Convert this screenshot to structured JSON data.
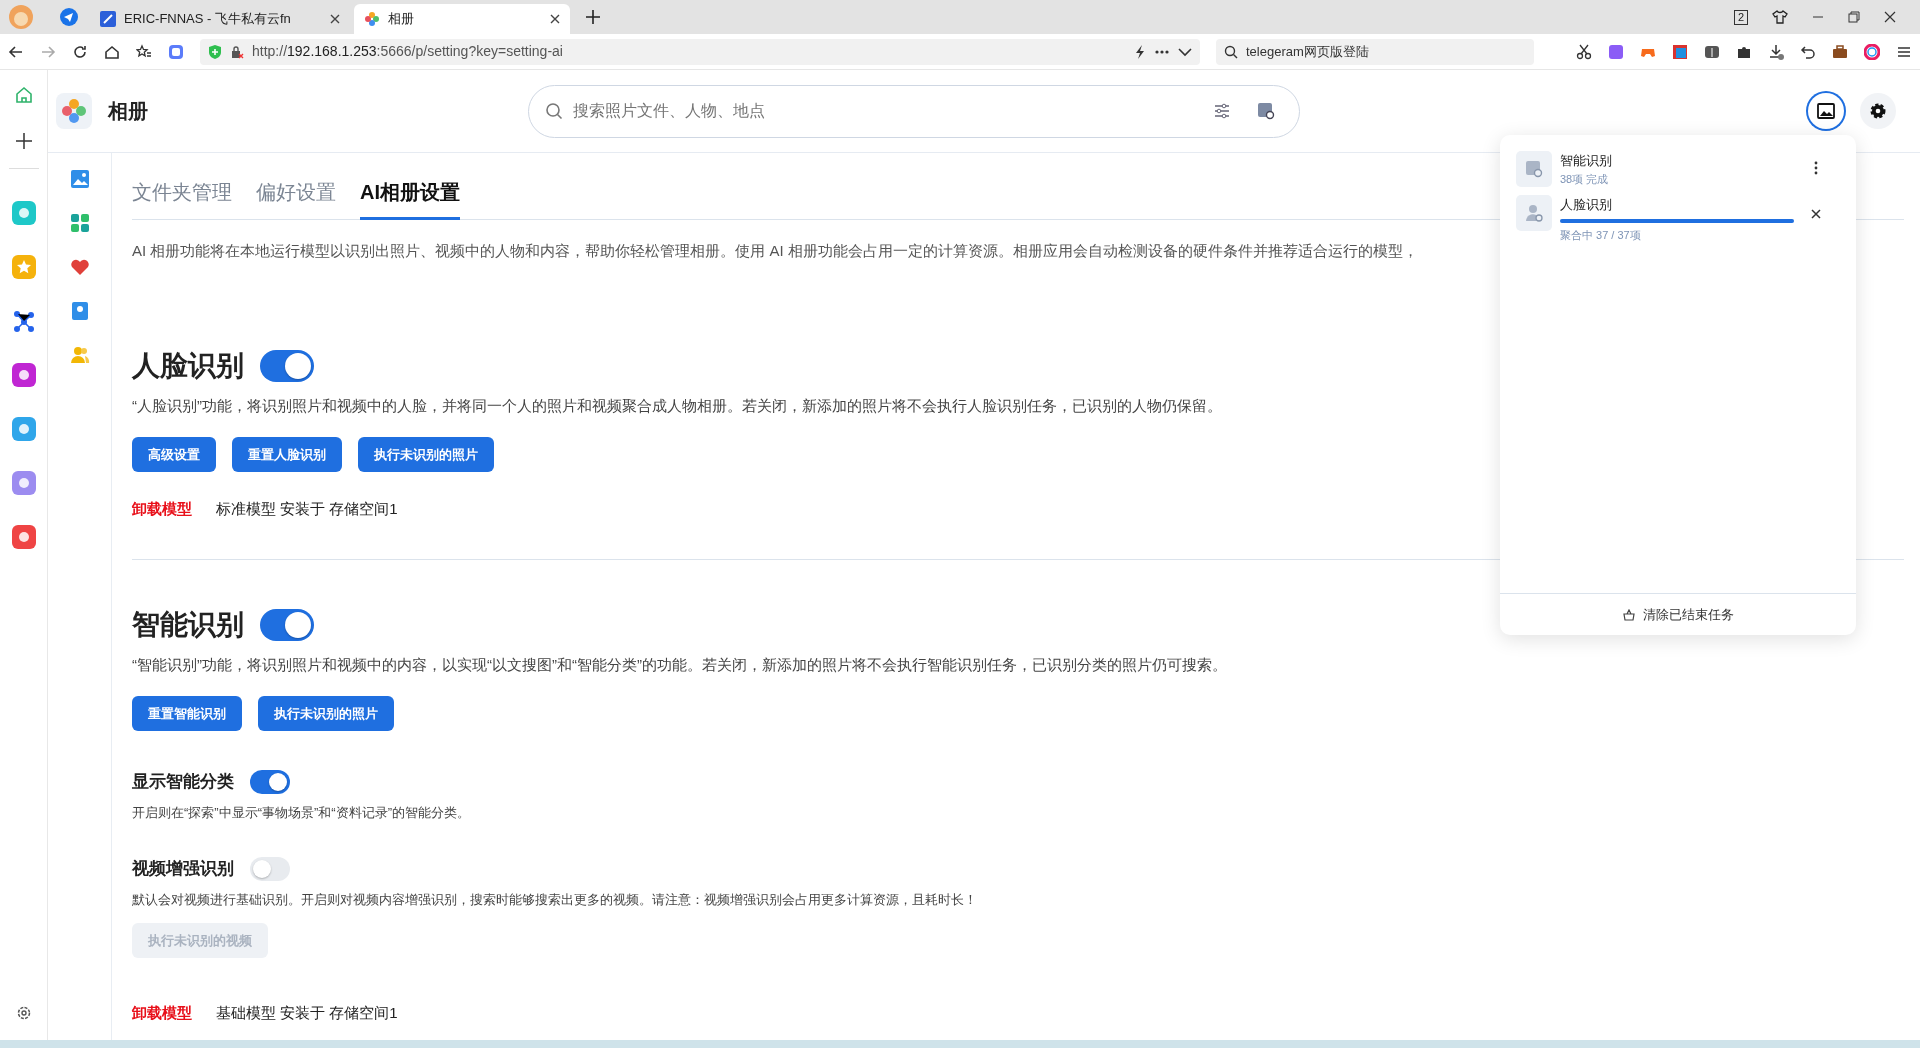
{
  "browser": {
    "tabs": [
      {
        "title": "ERIC-FNNAS - 飞牛私有云fn",
        "selected": false
      },
      {
        "title": "相册",
        "selected": true
      }
    ],
    "tab_count": "2",
    "url": {
      "scheme": "http://",
      "host": "192.168.1.253",
      "path": ":5666/p/setting?key=setting-ai"
    },
    "search": {
      "value": "telegeram网页版登陆"
    }
  },
  "app": {
    "title": "相册",
    "search": {
      "placeholder": "搜索照片文件、人物、地点"
    }
  },
  "tabs": [
    {
      "label": "文件夹管理",
      "selected": false
    },
    {
      "label": "偏好设置",
      "selected": false
    },
    {
      "label": "AI相册设置",
      "selected": true
    }
  ],
  "intro": "AI 相册功能将在本地运行模型以识别出照片、视频中的人物和内容，帮助你轻松管理相册。使用 AI 相册功能会占用一定的计算资源。相册应用会自动检测设备的硬件条件并推荐适合运行的模型，",
  "sections": [
    {
      "title": "人脸识别",
      "on": true,
      "description": "“人脸识别”功能，将识别照片和视频中的人脸，并将同一个人的照片和视频聚合成人物相册。若关闭，新添加的照片将不会执行人脸识别任务，已识别的人物仍保留。",
      "buttons": [
        {
          "label": "高级设置",
          "disabled": false
        },
        {
          "label": "重置人脸识别",
          "disabled": false
        },
        {
          "label": "执行未识别的照片",
          "disabled": false
        }
      ],
      "model": {
        "action": "卸载模型",
        "info": "标准模型 安装于 存储空间1"
      }
    },
    {
      "title": "智能识别",
      "on": true,
      "description": "“智能识别”功能，将识别照片和视频中的内容，以实现“以文搜图”和“智能分类”的功能。若关闭，新添加的照片将不会执行智能识别任务，已识别分类的照片仍可搜索。",
      "buttons": [
        {
          "label": "重置智能识别",
          "disabled": false
        },
        {
          "label": "执行未识别的照片",
          "disabled": false
        }
      ],
      "options": [
        {
          "title": "显示智能分类",
          "on": true,
          "description": "开启则在“探索”中显示“事物场景”和“资料记录”的智能分类。"
        },
        {
          "title": "视频增强识别",
          "on": false,
          "description": "默认会对视频进行基础识别。开启则对视频内容增强识别，搜索时能够搜索出更多的视频。请注意：视频增强识别会占用更多计算资源，且耗时长！",
          "buttons": [
            {
              "label": "执行未识别的视频",
              "disabled": true
            }
          ]
        }
      ],
      "model": {
        "action": "卸载模型",
        "info": "基础模型 安装于 存储空间1"
      }
    }
  ],
  "task_panel": {
    "tasks": [
      {
        "kind": "done",
        "name": "智能识别",
        "status": "38项 完成"
      },
      {
        "kind": "progress",
        "name": "人脸识别",
        "status": "聚合中 37 / 37项",
        "level": 1.0
      }
    ],
    "clear_button": "清除已结束任务"
  }
}
